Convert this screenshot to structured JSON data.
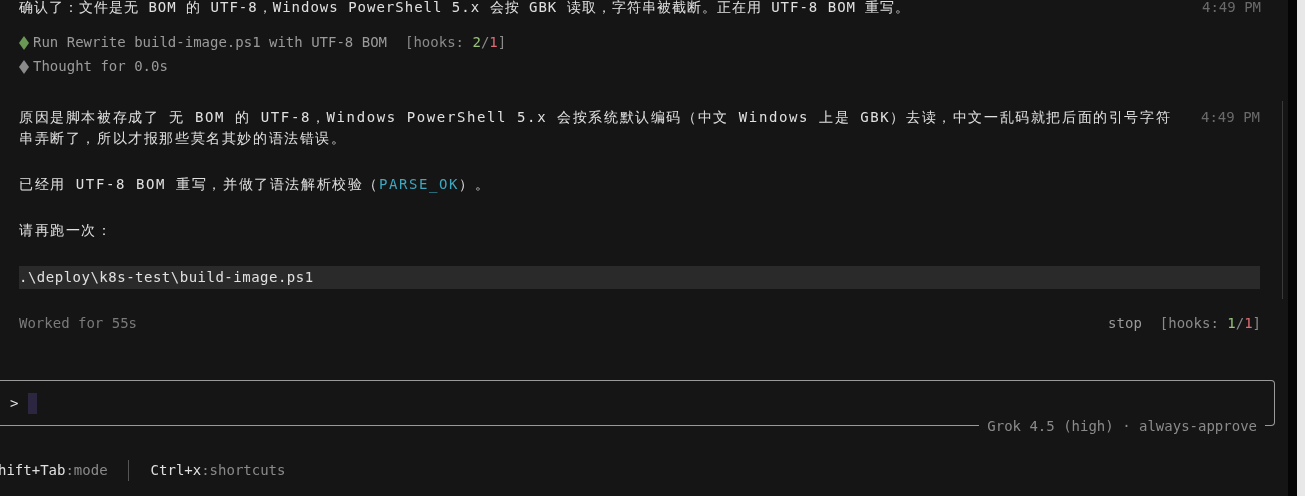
{
  "previous_message": {
    "text": "确认了：文件是无 BOM 的 UTF-8，Windows PowerShell 5.x 会按 GBK 读取，字符串被截断。正在用 UTF-8 BOM 重写。",
    "time": "4:49 PM"
  },
  "steps": [
    {
      "kind": "run",
      "color": "#6a9955",
      "label": "Run Rewrite build-image.ps1 with UTF-8 BOM",
      "hooks": {
        "prefix": "[hooks: ",
        "ok": "2",
        "separator": "/",
        "fail": "1",
        "suffix": "]"
      }
    },
    {
      "kind": "thought",
      "color": "#8a8a8a",
      "label": "Thought for 0.0s"
    }
  ],
  "message": {
    "time": "4:49 PM",
    "blocks": [
      {
        "kind": "text",
        "parts": [
          {
            "kind": "plain",
            "text": "原因是脚本被存成了 无 BOM 的 UTF-8，Windows PowerShell 5.x 会按系统默认编码（中文 Windows 上是 GBK）去读，中文一乱码就把后面的引号字符串弄断了，所以才报那些莫名其妙的语法错误。"
          }
        ]
      },
      {
        "kind": "text",
        "parts": [
          {
            "kind": "plain",
            "text": "已经用 UTF-8 BOM 重写，并做了语法解析校验（"
          },
          {
            "kind": "code",
            "text": "PARSE_OK"
          },
          {
            "kind": "plain",
            "text": "）。"
          }
        ]
      },
      {
        "kind": "text",
        "parts": [
          {
            "kind": "plain",
            "text": "请再跑一次："
          }
        ]
      },
      {
        "kind": "code",
        "parts": [
          {
            "kind": "plain",
            "text": ".\\deploy\\k8s-test\\build-image.ps1"
          }
        ]
      }
    ]
  },
  "summary": {
    "worked": "Worked for 55s",
    "stop": "stop",
    "hooks": {
      "prefix": "[hooks: ",
      "ok": "1",
      "separator": "/",
      "fail": "1",
      "suffix": "]"
    }
  },
  "input": {
    "prompt": ">",
    "model": "Grok 4.5 (high) · always-approve"
  },
  "shortcuts": [
    {
      "key": "hift+Tab",
      "action": ":mode"
    },
    {
      "key": "Ctrl+x",
      "action": ":shortcuts"
    }
  ]
}
